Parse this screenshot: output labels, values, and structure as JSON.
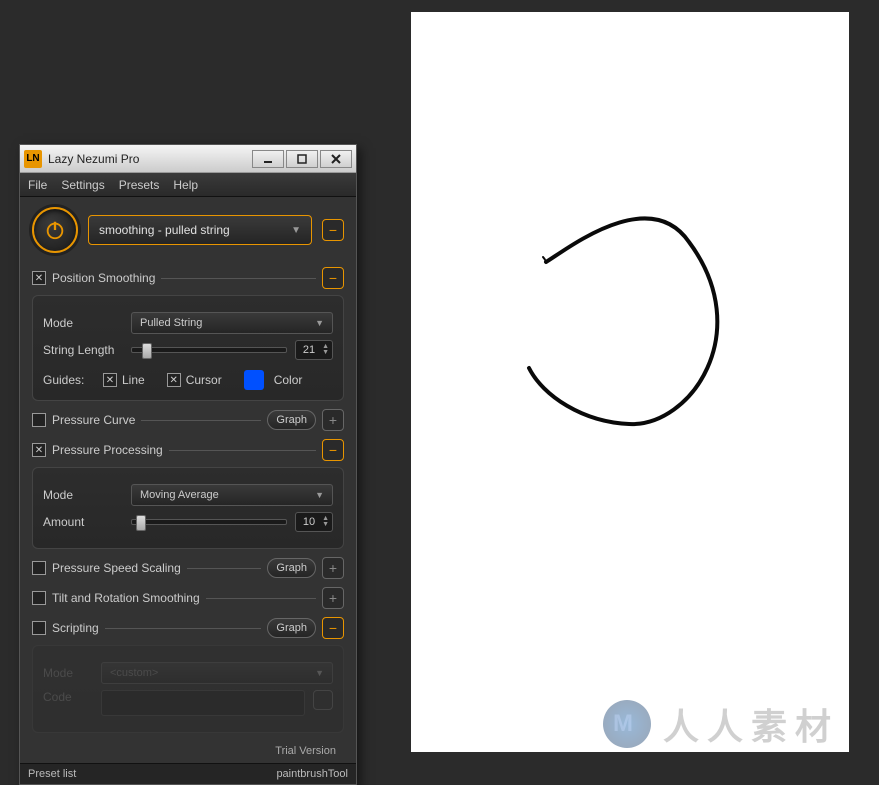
{
  "app": {
    "logo_text": "LN",
    "title": "Lazy Nezumi Pro"
  },
  "menu": {
    "file": "File",
    "settings": "Settings",
    "presets": "Presets",
    "help": "Help"
  },
  "preset": {
    "selected": "smoothing - pulled string"
  },
  "sections": {
    "position_smoothing": {
      "label": "Position Smoothing",
      "checked": true,
      "expanded": true
    },
    "pressure_curve": {
      "label": "Pressure Curve",
      "checked": false,
      "graph_btn": "Graph"
    },
    "pressure_processing": {
      "label": "Pressure Processing",
      "checked": true,
      "expanded": true
    },
    "pressure_speed_scaling": {
      "label": "Pressure Speed Scaling",
      "checked": false,
      "graph_btn": "Graph"
    },
    "tilt_rotation": {
      "label": "Tilt and Rotation Smoothing",
      "checked": false
    },
    "scripting": {
      "label": "Scripting",
      "checked": false,
      "graph_btn": "Graph",
      "expanded": true
    }
  },
  "position_panel": {
    "mode_label": "Mode",
    "mode_value": "Pulled String",
    "length_label": "String Length",
    "length_value": "21",
    "guides_label": "Guides:",
    "line_chk": "Line",
    "cursor_chk": "Cursor",
    "color_lbl": "Color"
  },
  "pressure_panel": {
    "mode_label": "Mode",
    "mode_value": "Moving Average",
    "amount_label": "Amount",
    "amount_value": "10"
  },
  "scripting_panel": {
    "mode_label": "Mode",
    "mode_value": "<custom>",
    "code_label": "Code"
  },
  "footer": {
    "left": "Preset list",
    "right": "paintbrushTool",
    "trial": "Trial Version"
  },
  "watermark": {
    "text": "人人素材",
    "logo": "M"
  }
}
